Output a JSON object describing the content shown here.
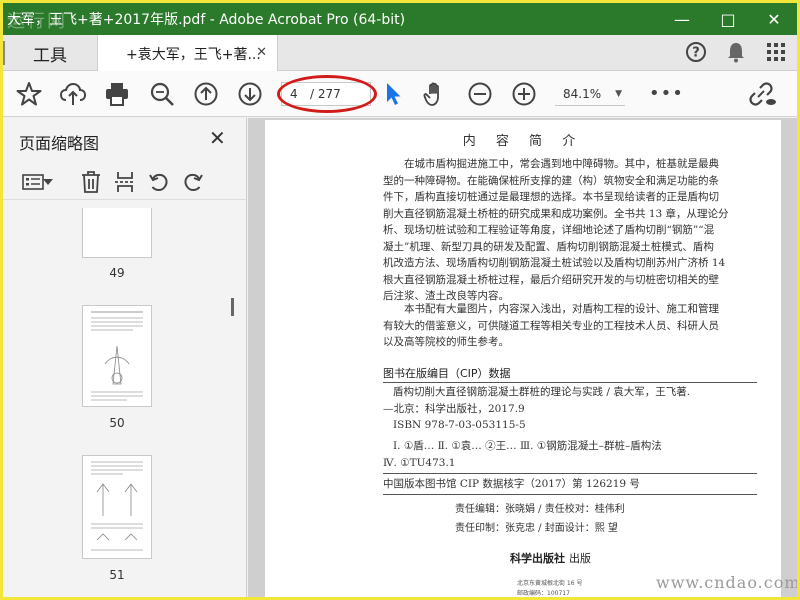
{
  "window": {
    "title": "大军，王飞+著+2017年版.pdf - Adobe Acrobat Pro (64-bit)",
    "watermark_logo": "运行网",
    "minimize": "—",
    "restore": "□",
    "close": "✕"
  },
  "tabs": {
    "tools_label": "工具",
    "doc_label": "+袁大军，王飞+著...",
    "doc_close": "✕"
  },
  "toolbar": {
    "current_page": "4",
    "total_pages": "/ 277",
    "zoom": "84.1%",
    "more": "•••",
    "accent": "#1a73e8",
    "highlight_color": "#d21b1b"
  },
  "panel": {
    "title": "页面缩略图",
    "close": "✕",
    "thumbnails": [
      {
        "label": "49"
      },
      {
        "label": "50"
      },
      {
        "label": "51"
      }
    ]
  },
  "document": {
    "heading": "内 容 简 介",
    "para1": [
      "在城市盾构掘进施工中，常会遇到地中障碍物。其中，桩基就是最典",
      "型的一种障碍物。在能确保桩所支撑的建（构）筑物安全和满足功能的条",
      "件下，盾构直接切桩通过是最理想的选择。本书呈现给读者的正是盾构切",
      "削大直径钢筋混凝土桥桩的研究成果和成功案例。全书共 13 章，从理论分",
      "析、现场切桩试验和工程验证等角度，详细地论述了盾构切削“钢筋”“混",
      "凝土”机理、新型刀具的研发及配置、盾构切削钢筋混凝土桩模式、盾构",
      "机改造方法、现场盾构切削钢筋混凝土桩试验以及盾构切削苏州广济桥 14",
      "根大直径钢筋混凝土桥桩过程，最后介绍研究开发的与切桩密切相关的壁",
      "后注浆、渣土改良等内容。"
    ],
    "para2": [
      "本书配有大量图片，内容深入浅出，对盾构工程的设计、施工和管理",
      "有较大的借鉴意义，可供隧道工程等相关专业的工程技术人员、科研人员",
      "以及高等院校的师生参考。"
    ],
    "cip_title": "图书在版编目（CIP）数据",
    "cip_lines": [
      "盾构切削大直径钢筋混凝土群桩的理论与实践 / 袁大军，王飞著.",
      "—北京：科学出版社，2017.9",
      "ISBN 978-7-03-053115-5",
      "Ⅰ. ①盾…  Ⅱ. ①袁…  ②王…  Ⅲ. ①钢筋混凝土–群桩–盾构法",
      "Ⅳ. ①TU473.1"
    ],
    "cip_number": "中国版本图书馆 CIP 数据核字（2017）第 126219 号",
    "credits1": "责任编辑：张晓娟 / 责任校对：桂伟利",
    "credits2": "责任印制：张克忠 / 封面设计：熙  望",
    "publisher": "科学出版社",
    "publisher_tail": "出版",
    "addr1": "北京东黄城根北街 16 号",
    "addr2": "邮政编码：100717"
  },
  "watermark": "www.cndao.com"
}
